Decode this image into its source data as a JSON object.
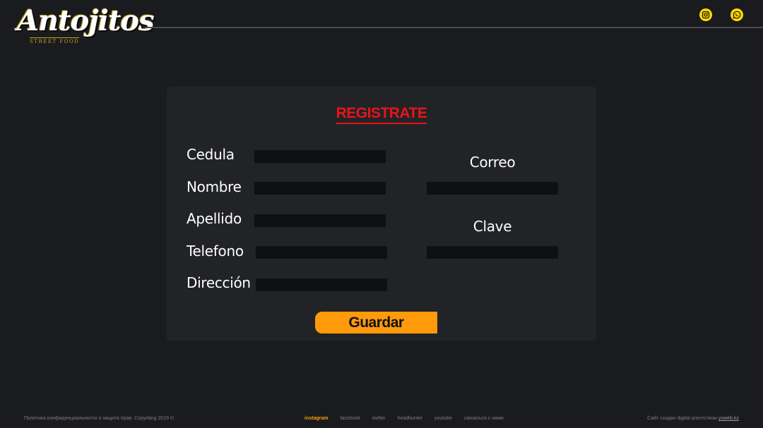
{
  "brand": {
    "name": "Antojitos",
    "tagline": "STREET FOOD",
    "accent": "#ffd900"
  },
  "header": {
    "social": [
      {
        "icon": "instagram-icon"
      },
      {
        "icon": "whatsapp-icon"
      }
    ]
  },
  "form": {
    "title": "REGISTRATE",
    "title_color": "#e8141a",
    "fields": {
      "cedula": {
        "label": "Cedula",
        "value": ""
      },
      "nombre": {
        "label": "Nombre",
        "value": ""
      },
      "apellido": {
        "label": "Apellido",
        "value": ""
      },
      "telefono": {
        "label": "Telefono",
        "value": ""
      },
      "direccion": {
        "label": "Dirección",
        "value": ""
      },
      "correo": {
        "label": "Correo",
        "value": ""
      },
      "clave": {
        "label": "Clave",
        "value": ""
      }
    },
    "submit_label": "Guardar",
    "submit_color": "#ff9a0a"
  },
  "footer": {
    "copyright": "Политика конфиденциальности и защита прав. Copyriting 2019 ©",
    "links": [
      {
        "label": "instagram",
        "active": true
      },
      {
        "label": "facebook",
        "active": false
      },
      {
        "label": "twitter",
        "active": false
      },
      {
        "label": "headhunter",
        "active": false
      },
      {
        "label": "youtube",
        "active": false
      },
      {
        "label": "связаться с нами",
        "active": false
      }
    ],
    "credit_text": "Сайт создан digital агентством",
    "credit_link": "yuweb.kz"
  }
}
